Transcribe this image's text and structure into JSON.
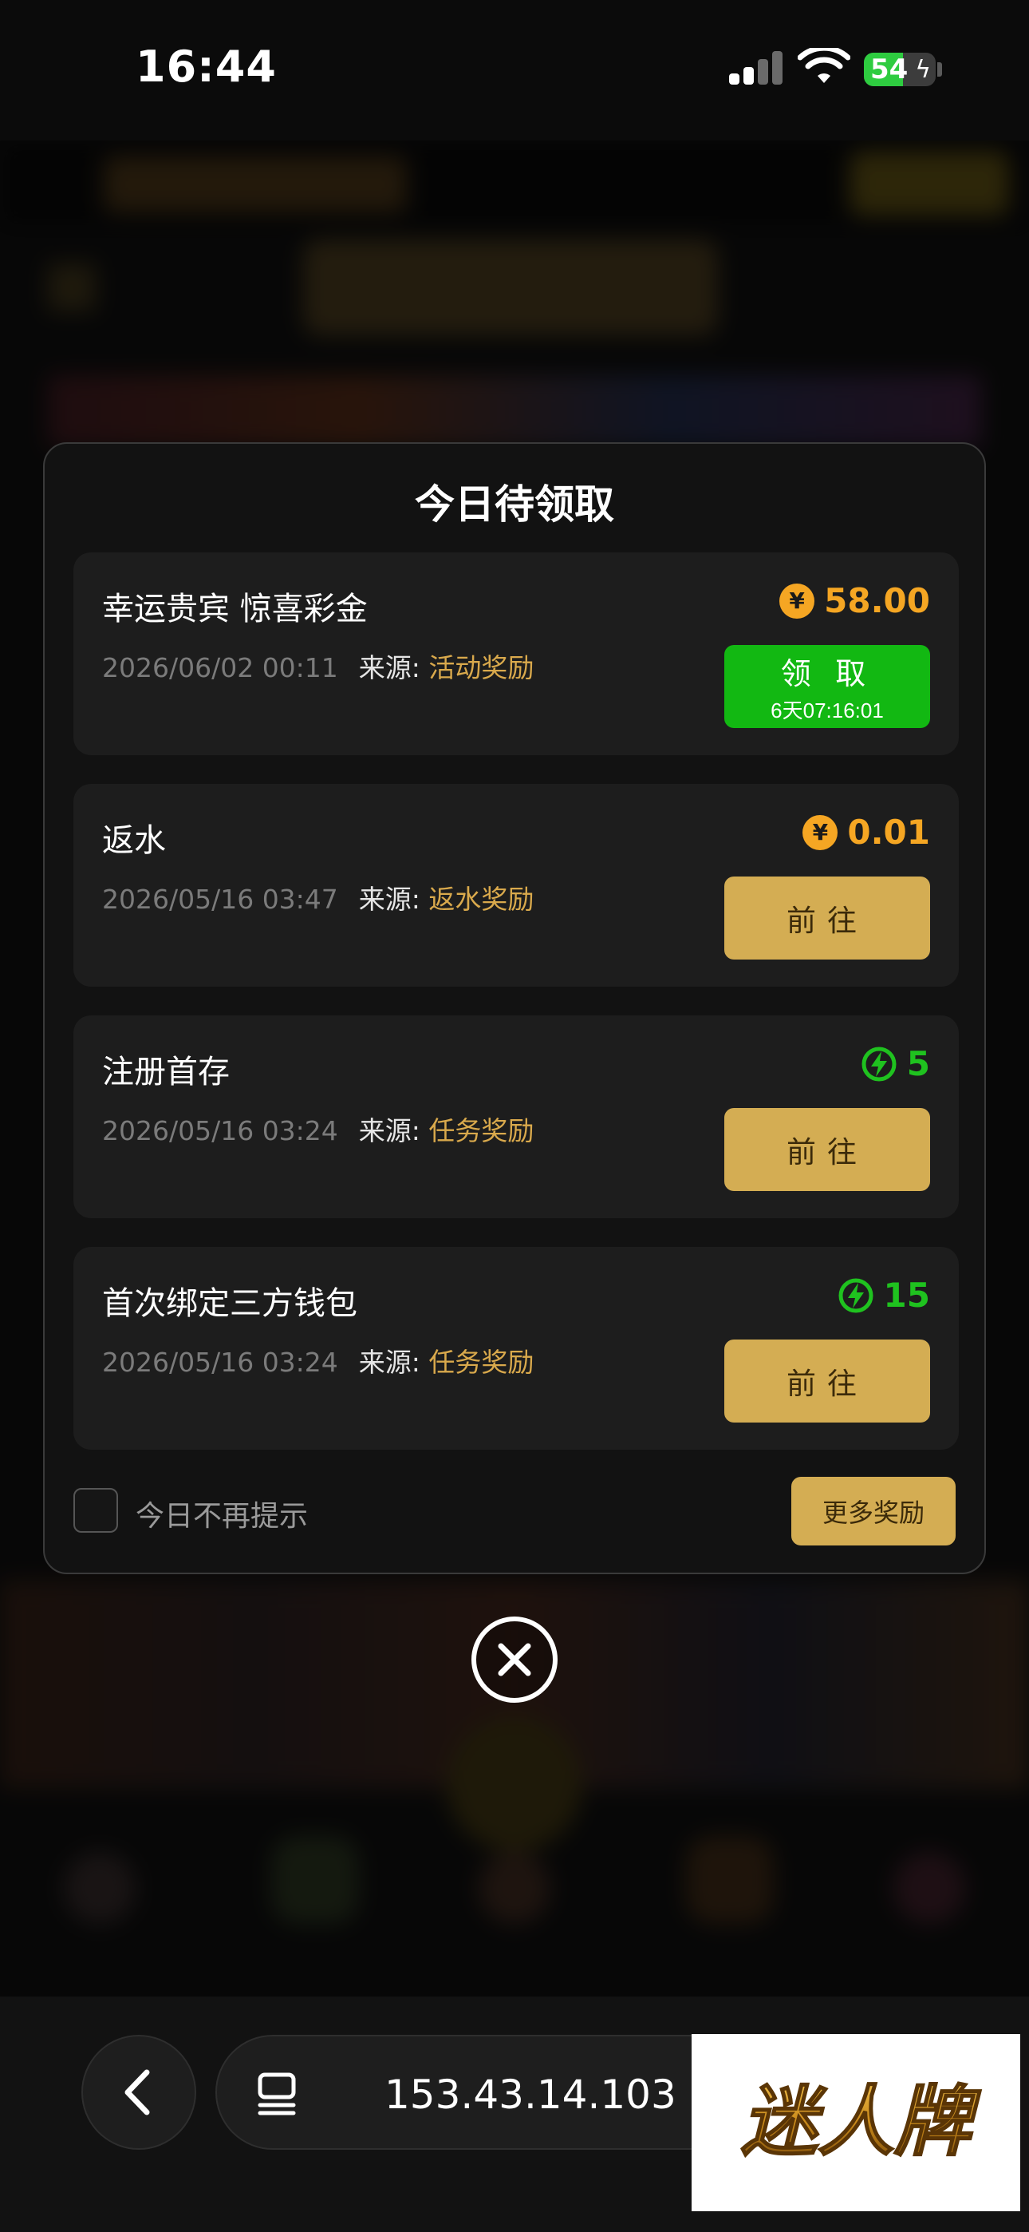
{
  "status_bar": {
    "time": "16:44",
    "battery": "54",
    "battery_level": 0.54
  },
  "modal": {
    "title": "今日待领取",
    "source_label": "来源: ",
    "items": [
      {
        "title": "幸运贵宾 惊喜彩金",
        "date": "2026/06/02 00:11",
        "source": "活动奖励",
        "reward_type": "coin",
        "amount": "58.00",
        "button_main": "领 取",
        "button_sub": "6天07:16:01"
      },
      {
        "title": "返水",
        "date": "2026/05/16 03:47",
        "source": "返水奖励",
        "reward_type": "coin",
        "amount": "0.01",
        "button_main": "前往"
      },
      {
        "title": "注册首存",
        "date": "2026/05/16 03:24",
        "source": "任务奖励",
        "reward_type": "energy",
        "amount": "5",
        "button_main": "前往"
      },
      {
        "title": "首次绑定三方钱包",
        "date": "2026/05/16 03:24",
        "source": "任务奖励",
        "reward_type": "energy",
        "amount": "15",
        "button_main": "前往"
      }
    ],
    "dont_show_label": "今日不再提示",
    "more_rewards_label": "更多奖励"
  },
  "browser": {
    "url": "153.43.14.103"
  },
  "watermark_text": "迷人牌",
  "colors": {
    "gold": "#d4ad53",
    "coin": "#f5a623",
    "green": "#12b812",
    "energy_green": "#1fc21f",
    "source_text": "#d9a94c"
  }
}
